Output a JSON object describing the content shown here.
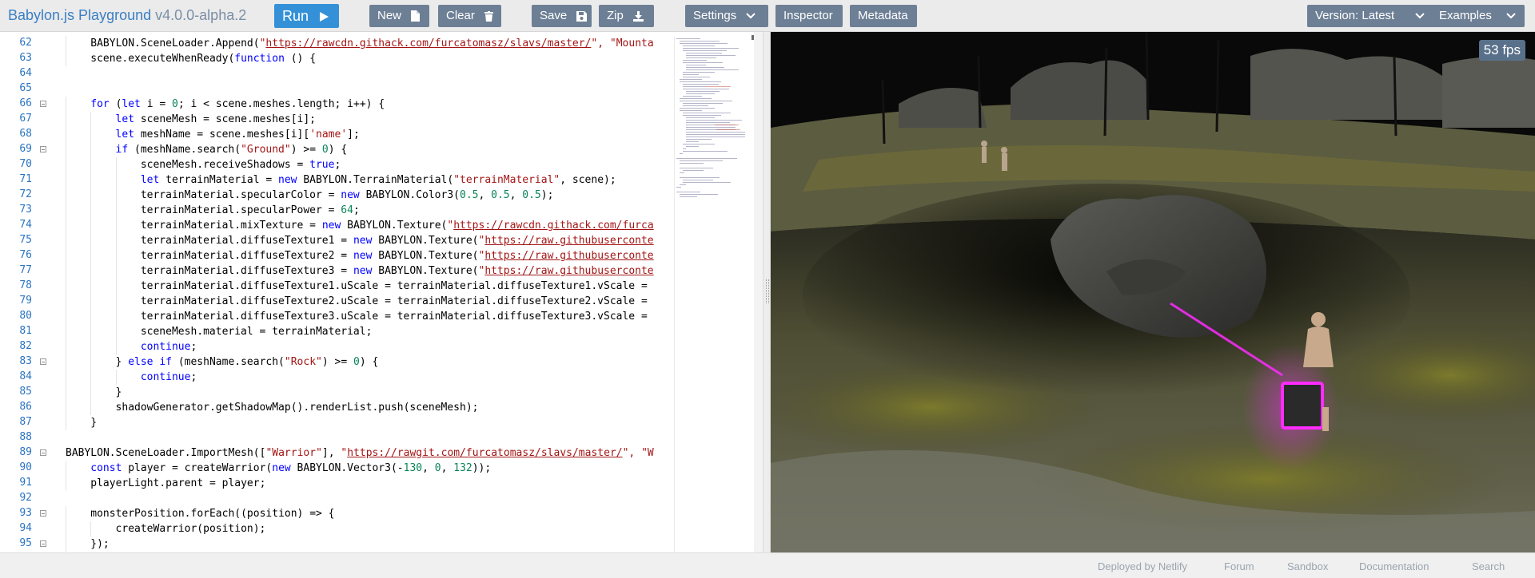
{
  "app": {
    "title": "Babylon.js Playground",
    "version": "v4.0.0-alpha.2"
  },
  "toolbar": {
    "run_label": "Run",
    "new_label": "New",
    "clear_label": "Clear",
    "save_label": "Save",
    "zip_label": "Zip",
    "settings_label": "Settings",
    "inspector_label": "Inspector",
    "metadata_label": "Metadata",
    "version_label": "Version: Latest",
    "examples_label": "Examples"
  },
  "editor": {
    "lines": [
      {
        "n": "62",
        "indent": 1,
        "fold": false,
        "tokens": [
          [
            "BABYLON.SceneLoader.Append(",
            ""
          ],
          [
            "\"",
            "st"
          ],
          [
            "https://rawcdn.githack.com/furcatomasz/slavs/master/",
            "st url"
          ],
          [
            "\", ",
            "st"
          ],
          [
            "\"Mounta",
            "st"
          ]
        ]
      },
      {
        "n": "63",
        "indent": 1,
        "fold": false,
        "tokens": [
          [
            "scene.executeWhenReady(",
            ""
          ],
          [
            "function",
            "kw"
          ],
          [
            " () {",
            ""
          ]
        ]
      },
      {
        "n": "64",
        "indent": 0,
        "fold": false,
        "tokens": []
      },
      {
        "n": "65",
        "indent": 0,
        "fold": false,
        "tokens": []
      },
      {
        "n": "66",
        "indent": 1,
        "fold": true,
        "tokens": [
          [
            "for",
            "kw"
          ],
          [
            " (",
            ""
          ],
          [
            "let",
            "kw"
          ],
          [
            " i = ",
            ""
          ],
          [
            "0",
            "nm"
          ],
          [
            "; i < scene.meshes.length; i++) {",
            ""
          ]
        ]
      },
      {
        "n": "67",
        "indent": 2,
        "fold": false,
        "tokens": [
          [
            "let",
            "kw"
          ],
          [
            " sceneMesh = scene.meshes[i];",
            ""
          ]
        ]
      },
      {
        "n": "68",
        "indent": 2,
        "fold": false,
        "tokens": [
          [
            "let",
            "kw"
          ],
          [
            " meshName = scene.meshes[i][",
            ""
          ],
          [
            "'name'",
            "st"
          ],
          [
            "];",
            ""
          ]
        ]
      },
      {
        "n": "69",
        "indent": 2,
        "fold": true,
        "tokens": [
          [
            "if",
            "kw"
          ],
          [
            " (meshName.search(",
            ""
          ],
          [
            "\"Ground\"",
            "st"
          ],
          [
            ") >= ",
            ""
          ],
          [
            "0",
            "nm"
          ],
          [
            ") {",
            ""
          ]
        ]
      },
      {
        "n": "70",
        "indent": 3,
        "fold": false,
        "tokens": [
          [
            "sceneMesh.receiveShadows = ",
            ""
          ],
          [
            "true",
            "kw"
          ],
          [
            ";",
            ""
          ]
        ]
      },
      {
        "n": "71",
        "indent": 3,
        "fold": false,
        "tokens": [
          [
            "let",
            "kw"
          ],
          [
            " terrainMaterial = ",
            ""
          ],
          [
            "new",
            "kw"
          ],
          [
            " BABYLON.TerrainMaterial(",
            ""
          ],
          [
            "\"terrainMaterial\"",
            "st"
          ],
          [
            ", scene);",
            ""
          ]
        ]
      },
      {
        "n": "72",
        "indent": 3,
        "fold": false,
        "tokens": [
          [
            "terrainMaterial.specularColor = ",
            ""
          ],
          [
            "new",
            "kw"
          ],
          [
            " BABYLON.Color3(",
            ""
          ],
          [
            "0.5",
            "nm"
          ],
          [
            ", ",
            ""
          ],
          [
            "0.5",
            "nm"
          ],
          [
            ", ",
            ""
          ],
          [
            "0.5",
            "nm"
          ],
          [
            ");",
            ""
          ]
        ]
      },
      {
        "n": "73",
        "indent": 3,
        "fold": false,
        "tokens": [
          [
            "terrainMaterial.specularPower = ",
            ""
          ],
          [
            "64",
            "nm"
          ],
          [
            ";",
            ""
          ]
        ]
      },
      {
        "n": "74",
        "indent": 3,
        "fold": false,
        "tokens": [
          [
            "terrainMaterial.mixTexture = ",
            ""
          ],
          [
            "new",
            "kw"
          ],
          [
            " BABYLON.Texture(",
            ""
          ],
          [
            "\"",
            "st"
          ],
          [
            "https://rawcdn.githack.com/furca",
            "st url"
          ]
        ]
      },
      {
        "n": "75",
        "indent": 3,
        "fold": false,
        "tokens": [
          [
            "terrainMaterial.diffuseTexture1 = ",
            ""
          ],
          [
            "new",
            "kw"
          ],
          [
            " BABYLON.Texture(",
            ""
          ],
          [
            "\"",
            "st"
          ],
          [
            "https://raw.githubuserconte",
            "st url"
          ]
        ]
      },
      {
        "n": "76",
        "indent": 3,
        "fold": false,
        "tokens": [
          [
            "terrainMaterial.diffuseTexture2 = ",
            ""
          ],
          [
            "new",
            "kw"
          ],
          [
            " BABYLON.Texture(",
            ""
          ],
          [
            "\"",
            "st"
          ],
          [
            "https://raw.githubuserconte",
            "st url"
          ]
        ]
      },
      {
        "n": "77",
        "indent": 3,
        "fold": false,
        "tokens": [
          [
            "terrainMaterial.diffuseTexture3 = ",
            ""
          ],
          [
            "new",
            "kw"
          ],
          [
            " BABYLON.Texture(",
            ""
          ],
          [
            "\"",
            "st"
          ],
          [
            "https://raw.githubuserconte",
            "st url"
          ]
        ]
      },
      {
        "n": "78",
        "indent": 3,
        "fold": false,
        "tokens": [
          [
            "terrainMaterial.diffuseTexture1.uScale = terrainMaterial.diffuseTexture1.vScale =",
            ""
          ]
        ]
      },
      {
        "n": "79",
        "indent": 3,
        "fold": false,
        "tokens": [
          [
            "terrainMaterial.diffuseTexture2.uScale = terrainMaterial.diffuseTexture2.vScale =",
            ""
          ]
        ]
      },
      {
        "n": "80",
        "indent": 3,
        "fold": false,
        "tokens": [
          [
            "terrainMaterial.diffuseTexture3.uScale = terrainMaterial.diffuseTexture3.vScale =",
            ""
          ]
        ]
      },
      {
        "n": "81",
        "indent": 3,
        "fold": false,
        "tokens": [
          [
            "sceneMesh.material = terrainMaterial;",
            ""
          ]
        ]
      },
      {
        "n": "82",
        "indent": 3,
        "fold": false,
        "tokens": [
          [
            "continue",
            "kw"
          ],
          [
            ";",
            ""
          ]
        ]
      },
      {
        "n": "83",
        "indent": 2,
        "fold": true,
        "tokens": [
          [
            "} ",
            ""
          ],
          [
            "else",
            "kw"
          ],
          [
            " ",
            ""
          ],
          [
            "if",
            "kw"
          ],
          [
            " (meshName.search(",
            ""
          ],
          [
            "\"Rock\"",
            "st"
          ],
          [
            ") >= ",
            ""
          ],
          [
            "0",
            "nm"
          ],
          [
            ") {",
            ""
          ]
        ]
      },
      {
        "n": "84",
        "indent": 3,
        "fold": false,
        "tokens": [
          [
            "continue",
            "kw"
          ],
          [
            ";",
            ""
          ]
        ]
      },
      {
        "n": "85",
        "indent": 2,
        "fold": false,
        "tokens": [
          [
            "}",
            ""
          ]
        ]
      },
      {
        "n": "86",
        "indent": 2,
        "fold": false,
        "tokens": [
          [
            "shadowGenerator.getShadowMap().renderList.push(sceneMesh);",
            ""
          ]
        ]
      },
      {
        "n": "87",
        "indent": 1,
        "fold": false,
        "tokens": [
          [
            "}",
            ""
          ]
        ]
      },
      {
        "n": "88",
        "indent": 0,
        "fold": false,
        "tokens": []
      },
      {
        "n": "89",
        "indent": 0,
        "fold": true,
        "tokens": [
          [
            "BABYLON.SceneLoader.ImportMesh([",
            ""
          ],
          [
            "\"Warrior\"",
            "st"
          ],
          [
            "], ",
            ""
          ],
          [
            "\"",
            "st"
          ],
          [
            "https://rawgit.com/furcatomasz/slavs/master/",
            "st url"
          ],
          [
            "\", ",
            "st"
          ],
          [
            "\"W",
            "st"
          ]
        ]
      },
      {
        "n": "90",
        "indent": 1,
        "fold": false,
        "tokens": [
          [
            "const",
            "kw"
          ],
          [
            " player = createWarrior(",
            ""
          ],
          [
            "new",
            "kw"
          ],
          [
            " BABYLON.Vector3(-",
            ""
          ],
          [
            "130",
            "nm"
          ],
          [
            ", ",
            ""
          ],
          [
            "0",
            "nm"
          ],
          [
            ", ",
            ""
          ],
          [
            "132",
            "nm"
          ],
          [
            "));",
            ""
          ]
        ]
      },
      {
        "n": "91",
        "indent": 1,
        "fold": false,
        "tokens": [
          [
            "playerLight.parent = player;",
            ""
          ]
        ]
      },
      {
        "n": "92",
        "indent": 0,
        "fold": false,
        "tokens": []
      },
      {
        "n": "93",
        "indent": 1,
        "fold": true,
        "tokens": [
          [
            "monsterPosition.forEach((position) => {",
            ""
          ]
        ]
      },
      {
        "n": "94",
        "indent": 2,
        "fold": false,
        "tokens": [
          [
            "createWarrior(position);",
            ""
          ]
        ]
      },
      {
        "n": "95",
        "indent": 1,
        "fold": true,
        "tokens": [
          [
            "});",
            ""
          ]
        ]
      }
    ]
  },
  "viewport": {
    "fps_label": "53 fps"
  },
  "footer": {
    "links": [
      "Deployed by Netlify",
      "Forum",
      "Sandbox",
      "Documentation",
      "Search"
    ]
  },
  "colors": {
    "accent": "#3591d7",
    "button": "#6d7f95",
    "keyword": "#0000ff",
    "string": "#a31515",
    "number": "#098658",
    "line_number": "#2b74c2",
    "glow": "#ff2bff"
  }
}
